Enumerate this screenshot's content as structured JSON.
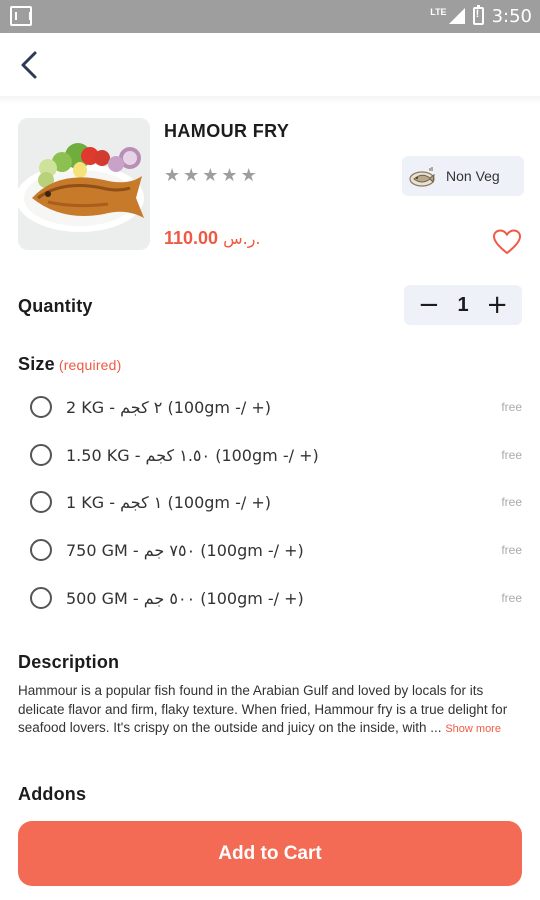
{
  "status_bar": {
    "network": "LTE",
    "time": "3:50"
  },
  "product": {
    "title": "HAMOUR FRY",
    "rating_stars": 5,
    "rating_filled": 0,
    "diet_tag": "Non Veg",
    "price": "110.00",
    "currency": "ر.س.",
    "favorite": false
  },
  "quantity": {
    "label": "Quantity",
    "minus": "−",
    "value": "1",
    "plus": "+"
  },
  "size": {
    "label": "Size",
    "required_label": "(required)",
    "options": [
      {
        "label": "2 KG - ٢ كجم (100gm -/ +)",
        "price": "free"
      },
      {
        "label": "1.50 KG - ١.٥٠ كجم (100gm -/ +)",
        "price": "free"
      },
      {
        "label": "1 KG - ١ كجم (100gm -/ +)",
        "price": "free"
      },
      {
        "label": "750 GM - ٧٥٠ جم (100gm -/ +)",
        "price": "free"
      },
      {
        "label": "500 GM - ٥٠٠ جم (100gm -/ +)",
        "price": "free"
      }
    ]
  },
  "description": {
    "label": "Description",
    "text": "Hammour is a popular fish found in the Arabian Gulf and loved by locals for its delicate flavor and firm, flaky texture. When fried, Hammour fry is a true delight for seafood lovers. It's crispy on the outside and juicy on the inside, with ...",
    "show_more": "Show more"
  },
  "addons": {
    "label": "Addons"
  },
  "cart": {
    "button_label": "Add to Cart"
  },
  "colors": {
    "accent": "#f05a43",
    "button": "#f36a55",
    "badge_bg": "#eef1f8"
  }
}
